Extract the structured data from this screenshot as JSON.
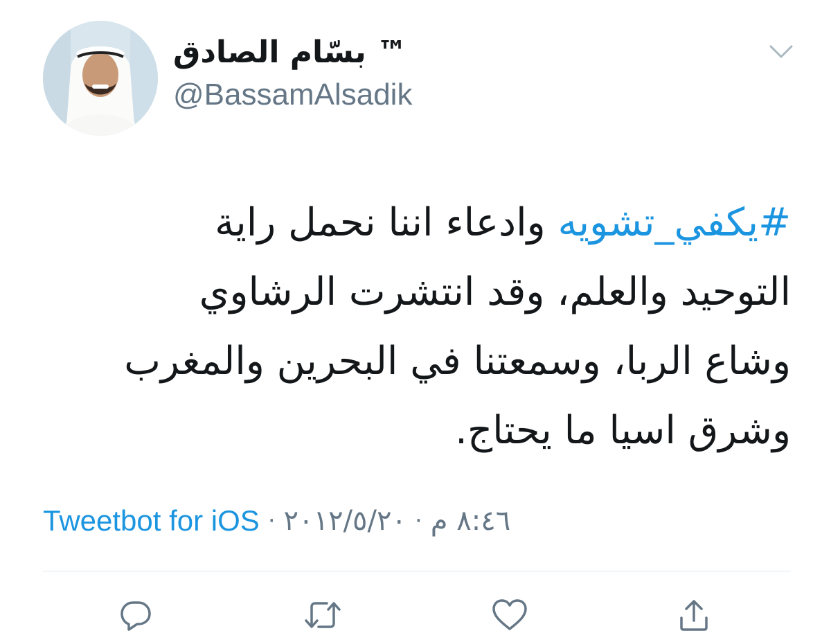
{
  "author": {
    "display_name": "بسّام الصادق ™",
    "handle": "@BassamAlsadik"
  },
  "tweet": {
    "hashtag": "#يكفي_تشويه",
    "line1_rest": " وادعاء اننا نحمل راية",
    "line2": "التوحيد والعلم، وقد انتشرت الرشاوي",
    "line3": "وشاع الربا، وسمعتنا في البحرين والمغرب",
    "line4": "وشرق اسيا ما يحتاج."
  },
  "meta": {
    "client": "Tweetbot for iOS",
    "separator": "·",
    "date": "٢٠١٢/٥/٢٠",
    "time": "٨:٤٦ م"
  },
  "icons": {
    "caret": "chevron-down-icon",
    "reply": "reply-icon",
    "retweet": "retweet-icon",
    "like": "heart-icon",
    "share": "share-icon"
  },
  "colors": {
    "link": "#1b95e0",
    "secondary_text": "#657786",
    "primary_text": "#14171a",
    "icon": "#657786",
    "divider": "#e1e8ed"
  }
}
